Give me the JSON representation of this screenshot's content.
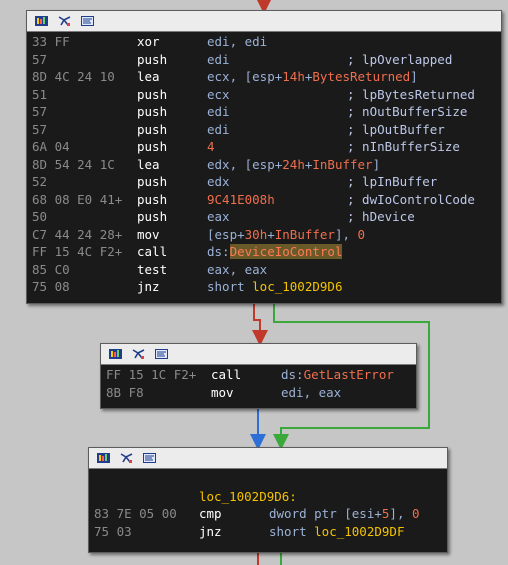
{
  "colors": {
    "background": "#c6c6c6",
    "node_bg": "#1a1a1a",
    "header_bg": "#ececec",
    "edge_red": "#c0392b",
    "edge_green": "#3aa83a",
    "edge_blue": "#2d6fd6"
  },
  "header_icons": [
    "graph-overview-icon",
    "flow-chart-icon",
    "text-view-icon"
  ],
  "node1": {
    "lines": [
      {
        "bytes": "33 FF",
        "mnem": "xor",
        "ops": [
          {
            "t": "edi, edi",
            "c": "opreg"
          }
        ],
        "cmt": ""
      },
      {
        "bytes": "57",
        "mnem": "push",
        "ops": [
          {
            "t": "edi",
            "c": "opreg"
          }
        ],
        "cmt": "; lpOverlapped"
      },
      {
        "bytes": "8D 4C 24 10",
        "mnem": "lea",
        "ops": [
          {
            "t": "ecx, [esp+",
            "c": "opreg"
          },
          {
            "t": "14h",
            "c": "num"
          },
          {
            "t": "+",
            "c": "opreg"
          },
          {
            "t": "BytesReturned",
            "c": "sym"
          },
          {
            "t": "]",
            "c": "opreg"
          }
        ],
        "cmt": ""
      },
      {
        "bytes": "51",
        "mnem": "push",
        "ops": [
          {
            "t": "ecx",
            "c": "opreg"
          }
        ],
        "cmt": "; lpBytesReturned"
      },
      {
        "bytes": "57",
        "mnem": "push",
        "ops": [
          {
            "t": "edi",
            "c": "opreg"
          }
        ],
        "cmt": "; nOutBufferSize"
      },
      {
        "bytes": "57",
        "mnem": "push",
        "ops": [
          {
            "t": "edi",
            "c": "opreg"
          }
        ],
        "cmt": "; lpOutBuffer"
      },
      {
        "bytes": "6A 04",
        "mnem": "push",
        "ops": [
          {
            "t": "4",
            "c": "num"
          }
        ],
        "cmt": "; nInBufferSize"
      },
      {
        "bytes": "8D 54 24 1C",
        "mnem": "lea",
        "ops": [
          {
            "t": "edx, [esp+",
            "c": "opreg"
          },
          {
            "t": "24h",
            "c": "num"
          },
          {
            "t": "+",
            "c": "opreg"
          },
          {
            "t": "InBuffer",
            "c": "sym"
          },
          {
            "t": "]",
            "c": "opreg"
          }
        ],
        "cmt": ""
      },
      {
        "bytes": "52",
        "mnem": "push",
        "ops": [
          {
            "t": "edx",
            "c": "opreg"
          }
        ],
        "cmt": "; lpInBuffer"
      },
      {
        "bytes": "68 08 E0 41+",
        "mnem": "push",
        "ops": [
          {
            "t": "9C41E008h",
            "c": "num"
          }
        ],
        "cmt": "; dwIoControlCode"
      },
      {
        "bytes": "50",
        "mnem": "push",
        "ops": [
          {
            "t": "eax",
            "c": "opreg"
          }
        ],
        "cmt": "; hDevice"
      },
      {
        "bytes": "C7 44 24 28+",
        "mnem": "mov",
        "ops": [
          {
            "t": "[esp+",
            "c": "opreg"
          },
          {
            "t": "30h",
            "c": "num"
          },
          {
            "t": "+",
            "c": "opreg"
          },
          {
            "t": "InBuffer",
            "c": "sym"
          },
          {
            "t": "], ",
            "c": "opreg"
          },
          {
            "t": "0",
            "c": "num"
          }
        ],
        "cmt": ""
      },
      {
        "bytes": "FF 15 4C F2+",
        "mnem": "call",
        "ops": [
          {
            "t": "ds:",
            "c": "opreg"
          },
          {
            "t": "DeviceIoControl",
            "c": "hl"
          }
        ],
        "cmt": ""
      },
      {
        "bytes": "85 C0",
        "mnem": "test",
        "ops": [
          {
            "t": "eax, eax",
            "c": "opreg"
          }
        ],
        "cmt": ""
      },
      {
        "bytes": "75 08",
        "mnem": "jnz",
        "ops": [
          {
            "t": "short ",
            "c": "opreg"
          },
          {
            "t": "loc_1002D9D6",
            "c": "lbl"
          }
        ],
        "cmt": ""
      }
    ]
  },
  "node2": {
    "lines": [
      {
        "bytes": "FF 15 1C F2+",
        "mnem": "call",
        "ops": [
          {
            "t": "ds:",
            "c": "opreg"
          },
          {
            "t": "GetLastError",
            "c": "apic"
          }
        ],
        "cmt": ""
      },
      {
        "bytes": "8B F8",
        "mnem": "mov",
        "ops": [
          {
            "t": "edi, eax",
            "c": "opreg"
          }
        ],
        "cmt": ""
      }
    ]
  },
  "node3": {
    "label": "loc_1002D9D6:",
    "lines": [
      {
        "bytes": "83 7E 05 00",
        "mnem": "cmp",
        "ops": [
          {
            "t": "dword ptr [esi+",
            "c": "opreg"
          },
          {
            "t": "5",
            "c": "num"
          },
          {
            "t": "], ",
            "c": "opreg"
          },
          {
            "t": "0",
            "c": "num"
          }
        ],
        "cmt": ""
      },
      {
        "bytes": "75 03",
        "mnem": "jnz",
        "ops": [
          {
            "t": "short ",
            "c": "opreg"
          },
          {
            "t": "loc_1002D9DF",
            "c": "lbl"
          }
        ],
        "cmt": ""
      }
    ]
  }
}
